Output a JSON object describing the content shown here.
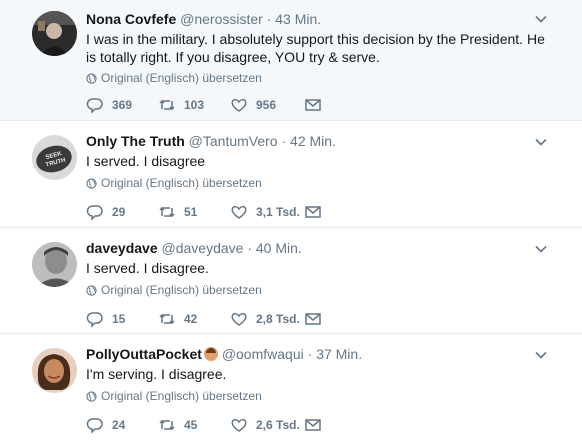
{
  "tweets": [
    {
      "name": "Nona Covfefe",
      "handle": "@nerossister",
      "time": "43 Min.",
      "text": "I was in the military. I absolutely support this decision by the President. He is totally right. If you disagree, YOU try & serve.",
      "translate": "Original (Englisch) übersetzen",
      "replies": "369",
      "retweets": "103",
      "likes": "956"
    },
    {
      "name": "Only The Truth",
      "handle": "@TantumVero",
      "time": "42 Min.",
      "text": "I served. I disagree",
      "translate": "Original (Englisch) übersetzen",
      "replies": "29",
      "retweets": "51",
      "likes": "3,1 Tsd."
    },
    {
      "name": "daveydave",
      "handle": "@daveydave",
      "time": "40 Min.",
      "text": "I served. I disagree.",
      "translate": "Original (Englisch) übersetzen",
      "replies": "15",
      "retweets": "42",
      "likes": "2,8 Tsd."
    },
    {
      "name": "PollyOuttaPocket",
      "handle": "@oomfwaqui",
      "time": "37 Min.",
      "text": "I'm serving. I disagree.",
      "translate": "Original (Englisch) übersetzen",
      "replies": "24",
      "retweets": "45",
      "likes": "2,6 Tsd."
    }
  ],
  "avatar_texts": {
    "truth": "SEEK TRUTH"
  },
  "separator": "·",
  "colors": {
    "text": "#14171a",
    "muted": "#657786",
    "thread": "#c4d4e0",
    "highlight_bg": "#f5f8fa"
  }
}
